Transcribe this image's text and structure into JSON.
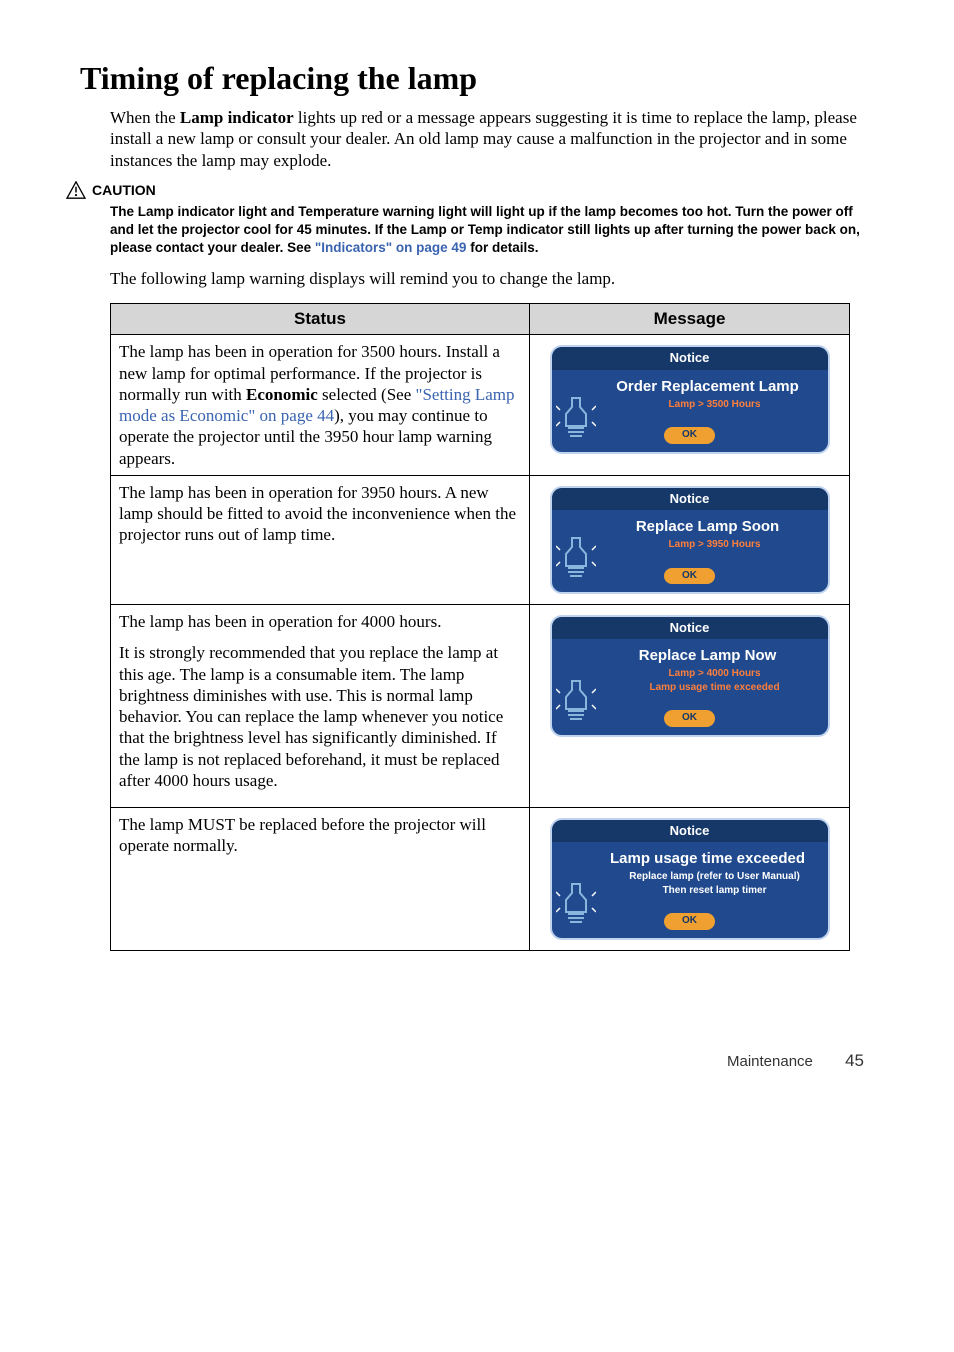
{
  "header": {
    "title": "Timing of replacing the lamp",
    "intro_pre": "When the ",
    "intro_bold": "Lamp indicator",
    "intro_post": " lights up red or a message appears suggesting it is time to replace the lamp, please install a new lamp or consult your dealer. An old lamp may cause a malfunction in the projector and in some instances the lamp may explode."
  },
  "caution": {
    "label": "CAUTION",
    "body_pre": "The Lamp indicator light and Temperature warning light will light up if the lamp becomes too hot. Turn the power off and let the projector cool for 45 minutes. If the Lamp or Temp indicator still lights up after turning the power back on, please contact your dealer. See ",
    "body_link": "\"Indicators\" on page 49",
    "body_post": " for details."
  },
  "lead": "The following lamp warning displays will remind you to change the lamp.",
  "table": {
    "col_status": "Status",
    "col_msg": "Message"
  },
  "rows": [
    {
      "status": {
        "p1_pre": "The lamp has been in operation for 3500 hours. Install a new lamp for optimal performance. If the projector is normally run with ",
        "p1_bold": "Economic",
        "p1_mid": " selected (See ",
        "p1_link": "\"Setting Lamp mode as Economic\" on page 44",
        "p1_post": "), you may continue to operate the projector until the 3950 hour lamp warning appears."
      },
      "osd": {
        "title": "Notice",
        "main": "Order Replacement Lamp",
        "sub1": "Lamp > 3500 Hours",
        "sub2": "",
        "sub_white": false,
        "ok": "OK"
      }
    },
    {
      "status": {
        "text": "The lamp has been in operation for 3950 hours. A new lamp should be fitted to avoid the inconvenience when the projector runs out of lamp time."
      },
      "osd": {
        "title": "Notice",
        "main": "Replace Lamp Soon",
        "sub1": "Lamp > 3950 Hours",
        "sub2": "",
        "sub_white": false,
        "ok": "OK"
      }
    },
    {
      "status": {
        "p1": "The lamp has been in operation for 4000 hours.",
        "p2": "It is strongly recommended that you replace the lamp at this age. The lamp is a consumable item. The lamp brightness diminishes with use. This is normal lamp behavior. You can replace the lamp whenever you notice that the brightness level has significantly diminished. If the lamp is not replaced beforehand, it must be replaced after 4000 hours usage."
      },
      "osd": {
        "title": "Notice",
        "main": "Replace Lamp Now",
        "sub1": "Lamp > 4000 Hours",
        "sub2": "Lamp usage time exceeded",
        "sub_white": false,
        "ok": "OK"
      }
    },
    {
      "status": {
        "text": "The lamp MUST be replaced before the projector will operate normally."
      },
      "osd": {
        "title": "Notice",
        "main": "Lamp usage time exceeded",
        "sub1": "Replace lamp (refer to User Manual)",
        "sub2": "Then reset lamp timer",
        "sub_white": true,
        "ok": "OK"
      }
    }
  ],
  "footer": {
    "section": "Maintenance",
    "page": "45"
  }
}
